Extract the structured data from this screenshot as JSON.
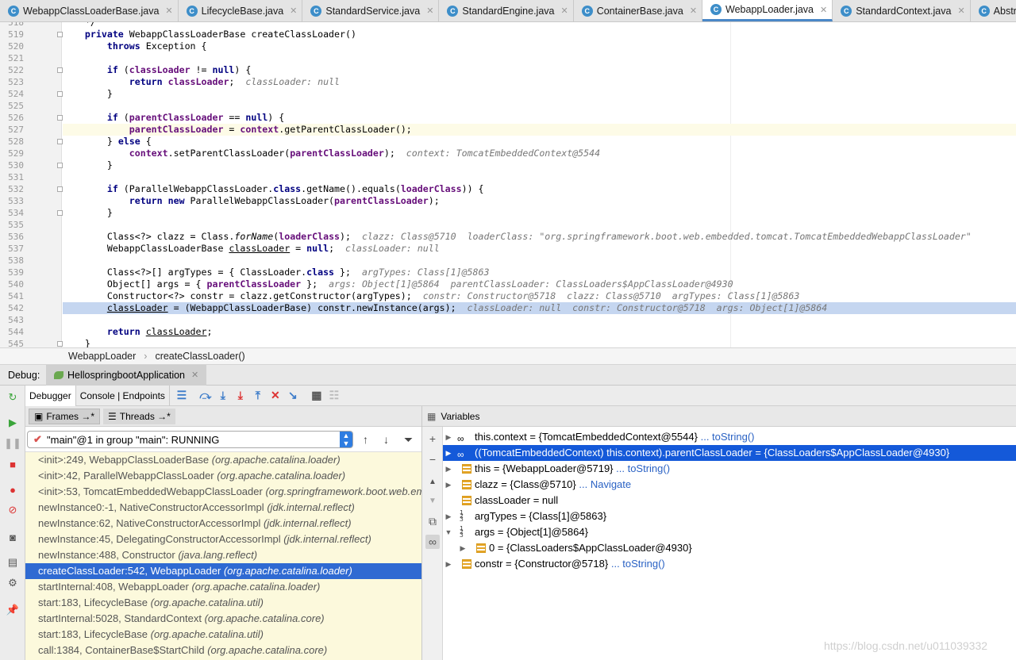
{
  "tabs": [
    {
      "label": "WebappClassLoaderBase.java",
      "active": false
    },
    {
      "label": "LifecycleBase.java",
      "active": false
    },
    {
      "label": "StandardService.java",
      "active": false
    },
    {
      "label": "StandardEngine.java",
      "active": false
    },
    {
      "label": "ContainerBase.java",
      "active": false
    },
    {
      "label": "WebappLoader.java",
      "active": true
    },
    {
      "label": "StandardContext.java",
      "active": false
    },
    {
      "label": "AbstractExecutorServic",
      "active": false
    }
  ],
  "editor": {
    "lines": [
      {
        "n": "518",
        "html": "    */"
      },
      {
        "n": "519",
        "html": "    <span class=\"kw\">private</span> WebappClassLoaderBase createClassLoader()"
      },
      {
        "n": "520",
        "html": "        <span class=\"kw\">throws</span> Exception {"
      },
      {
        "n": "521",
        "html": ""
      },
      {
        "n": "522",
        "html": "        <span class=\"kw\">if</span> (<span class=\"fld\">classLoader</span> != <span class=\"kw\">null</span>) {"
      },
      {
        "n": "523",
        "html": "            <span class=\"kw\">return</span> <span class=\"fld\">classLoader</span>;  <span class=\"dbg\">classLoader: null</span>"
      },
      {
        "n": "524",
        "html": "        }"
      },
      {
        "n": "525",
        "html": ""
      },
      {
        "n": "526",
        "html": "        <span class=\"kw\">if</span> (<span class=\"fld\">parentClassLoader</span> == <span class=\"kw\">null</span>) {"
      },
      {
        "n": "527",
        "html": "            <span class=\"fld\">parentClassLoader</span> = <span class=\"fld\">context</span>.getParentClassLoader();",
        "cls": "cur"
      },
      {
        "n": "528",
        "html": "        } <span class=\"kw\">else</span> {"
      },
      {
        "n": "529",
        "html": "            <span class=\"fld\">context</span>.setParentClassLoader(<span class=\"fld\">parentClassLoader</span>);  <span class=\"dbg\">context: TomcatEmbeddedContext@5544</span>"
      },
      {
        "n": "530",
        "html": "        }"
      },
      {
        "n": "531",
        "html": ""
      },
      {
        "n": "532",
        "html": "        <span class=\"kw\">if</span> (ParallelWebappClassLoader.<span class=\"kw\">class</span>.getName().equals(<span class=\"fld\">loaderClass</span>)) {"
      },
      {
        "n": "533",
        "html": "            <span class=\"kw\">return new</span> ParallelWebappClassLoader(<span class=\"fld\">parentClassLoader</span>);"
      },
      {
        "n": "534",
        "html": "        }"
      },
      {
        "n": "535",
        "html": ""
      },
      {
        "n": "536",
        "html": "        Class&lt;?&gt; clazz = Class.<span class=\"itl\">forName</span>(<span class=\"fld\">loaderClass</span>);  <span class=\"dbg\">clazz: Class@5710  loaderClass: \"org.springframework.boot.web.embedded.tomcat.TomcatEmbeddedWebappClassLoader\"</span>"
      },
      {
        "n": "537",
        "html": "        WebappClassLoaderBase <span class=\"und\">classLoader</span> = <span class=\"kw\">null</span>;  <span class=\"dbg\">classLoader: null</span>"
      },
      {
        "n": "538",
        "html": ""
      },
      {
        "n": "539",
        "html": "        Class&lt;?&gt;[] argTypes = { ClassLoader.<span class=\"kw\">class</span> };  <span class=\"dbg\">argTypes: Class[1]@5863</span>"
      },
      {
        "n": "540",
        "html": "        Object[] args = { <span class=\"fld\">parentClassLoader</span> };  <span class=\"dbg\">args: Object[1]@5864  parentClassLoader: ClassLoaders$AppClassLoader@4930</span>"
      },
      {
        "n": "541",
        "html": "        Constructor&lt;?&gt; constr = clazz.getConstructor(argTypes);  <span class=\"dbg\">constr: Constructor@5718  clazz: Class@5710  argTypes: Class[1]@5863</span>"
      },
      {
        "n": "542",
        "html": "        <span class=\"und\">classLoader</span> = (WebappClassLoaderBase) constr.newInstance(args);  <span class=\"dbg\">classLoader: null  constr: Constructor@5718  args: Object[1]@5864</span>",
        "cls": "exec"
      },
      {
        "n": "543",
        "html": ""
      },
      {
        "n": "544",
        "html": "        <span class=\"kw\">return</span> <span class=\"und\">classLoader</span>;"
      },
      {
        "n": "545",
        "html": "    }"
      }
    ]
  },
  "breadcrumb": {
    "part1": "WebappLoader",
    "sep": "›",
    "part2": "createClassLoader()"
  },
  "debugbar": {
    "label": "Debug:",
    "config": "HellospringbootApplication"
  },
  "toolbar2": {
    "debugger": "Debugger",
    "console": "Console | Endpoints"
  },
  "frames_head": {
    "frames": "Frames →*",
    "threads": "Threads →*"
  },
  "thread_select": {
    "value": "\"main\"@1 in group \"main\": RUNNING"
  },
  "frames": [
    {
      "m": "<init>:249, WebappClassLoaderBase",
      "p": "(org.apache.catalina.loader)"
    },
    {
      "m": "<init>:42, ParallelWebappClassLoader",
      "p": "(org.apache.catalina.loader)"
    },
    {
      "m": "<init>:53, TomcatEmbeddedWebappClassLoader",
      "p": "(org.springframework.boot.web.embedded.tomcat)"
    },
    {
      "m": "newInstance0:-1, NativeConstructorAccessorImpl",
      "p": "(jdk.internal.reflect)"
    },
    {
      "m": "newInstance:62, NativeConstructorAccessorImpl",
      "p": "(jdk.internal.reflect)"
    },
    {
      "m": "newInstance:45, DelegatingConstructorAccessorImpl",
      "p": "(jdk.internal.reflect)"
    },
    {
      "m": "newInstance:488, Constructor",
      "p": "(java.lang.reflect)"
    },
    {
      "m": "createClassLoader:542, WebappLoader",
      "p": "(org.apache.catalina.loader)",
      "sel": true
    },
    {
      "m": "startInternal:408, WebappLoader",
      "p": "(org.apache.catalina.loader)"
    },
    {
      "m": "start:183, LifecycleBase",
      "p": "(org.apache.catalina.util)"
    },
    {
      "m": "startInternal:5028, StandardContext",
      "p": "(org.apache.catalina.core)"
    },
    {
      "m": "start:183, LifecycleBase",
      "p": "(org.apache.catalina.util)"
    },
    {
      "m": "call:1384, ContainerBase$StartChild",
      "p": "(org.apache.catalina.core)"
    }
  ],
  "variables_head": "Variables",
  "variables": [
    {
      "indent": 0,
      "arrow": "▶",
      "icon": "watch",
      "text": "this.context = {TomcatEmbeddedContext@5544}",
      "link": "... toString()"
    },
    {
      "indent": 0,
      "arrow": "▶",
      "icon": "watch",
      "text": "((TomcatEmbeddedContext) this.context).parentClassLoader = {ClassLoaders$AppClassLoader@4930}",
      "link": "",
      "sel": true
    },
    {
      "indent": 0,
      "arrow": "▶",
      "icon": "field",
      "text": "this = {WebappLoader@5719}",
      "link": "... toString()"
    },
    {
      "indent": 0,
      "arrow": "▶",
      "icon": "field",
      "text": "clazz = {Class@5710}",
      "link": "... Navigate"
    },
    {
      "indent": 0,
      "arrow": "",
      "icon": "field",
      "text": "classLoader = null",
      "link": ""
    },
    {
      "indent": 0,
      "arrow": "▶",
      "icon": "array",
      "text": "argTypes = {Class[1]@5863}",
      "link": ""
    },
    {
      "indent": 0,
      "arrow": "▼",
      "icon": "array",
      "text": "args = {Object[1]@5864}",
      "link": ""
    },
    {
      "indent": 1,
      "arrow": "▶",
      "icon": "field",
      "text": "0 = {ClassLoaders$AppClassLoader@4930}",
      "link": ""
    },
    {
      "indent": 0,
      "arrow": "▶",
      "icon": "field",
      "text": "constr = {Constructor@5718}",
      "link": "... toString()"
    }
  ],
  "watermark": "https://blog.csdn.net/u011039332"
}
